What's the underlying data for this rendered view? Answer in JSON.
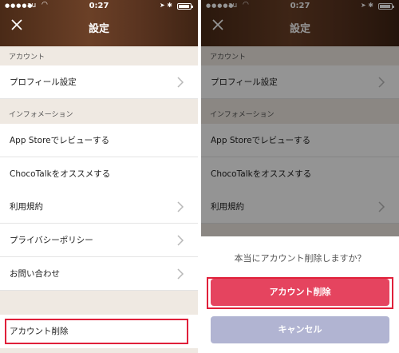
{
  "status": {
    "carrier": "au",
    "time": "0:27"
  },
  "header": {
    "title": "設定"
  },
  "sections": [
    {
      "label": "アカウント"
    },
    {
      "label": "インフォメーション"
    }
  ],
  "rows": [
    {
      "label": "プロフィール設定"
    },
    {
      "label": "App Storeでレビューする"
    },
    {
      "label": "ChocoTalkをオススメする"
    },
    {
      "label": "利用規約"
    },
    {
      "label": "プライバシーポリシー"
    },
    {
      "label": "お問い合わせ"
    },
    {
      "label": "アカウント削除"
    }
  ],
  "dialog": {
    "prompt": "本当にアカウント削除しますか？",
    "confirm_label": "アカウント削除",
    "cancel_label": "キャンセル"
  },
  "colors": {
    "header": "#5a3420",
    "background": "#efe9e2",
    "delete_button": "#e5445f",
    "cancel_button": "#b1b4d2",
    "highlight": "#e0203a"
  }
}
